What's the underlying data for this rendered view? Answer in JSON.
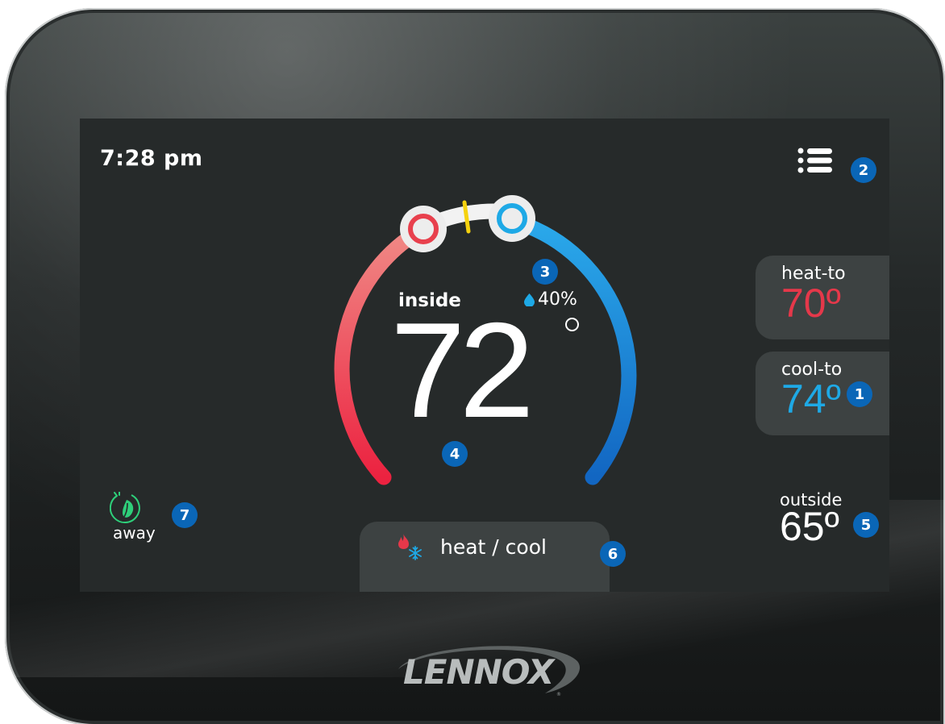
{
  "clock": {
    "time": "7:28 pm"
  },
  "menu": {
    "icon": "list-menu-icon"
  },
  "indoor": {
    "label": "inside",
    "temperature": "72",
    "humidity": "40%"
  },
  "setpoints": {
    "heat": {
      "label": "heat-to",
      "value": "70º"
    },
    "cool": {
      "label": "cool-to",
      "value": "74º"
    }
  },
  "outdoor": {
    "label": "outside",
    "value": "65º"
  },
  "mode": {
    "label": "heat / cool",
    "icon": "flame-snowflake-icon"
  },
  "away": {
    "label": "away",
    "icon": "leaf-plug-icon"
  },
  "brand": {
    "logo_text": "LENNOX"
  },
  "callouts": [
    "1",
    "2",
    "3",
    "4",
    "5",
    "6",
    "7"
  ],
  "colors": {
    "heat": "#e5384a",
    "cool": "#1ea9e6",
    "callout": "#0a66b7",
    "screen_bg": "#262a2a",
    "panel_bg": "#3d4242",
    "eco": "#2ecf7a"
  }
}
